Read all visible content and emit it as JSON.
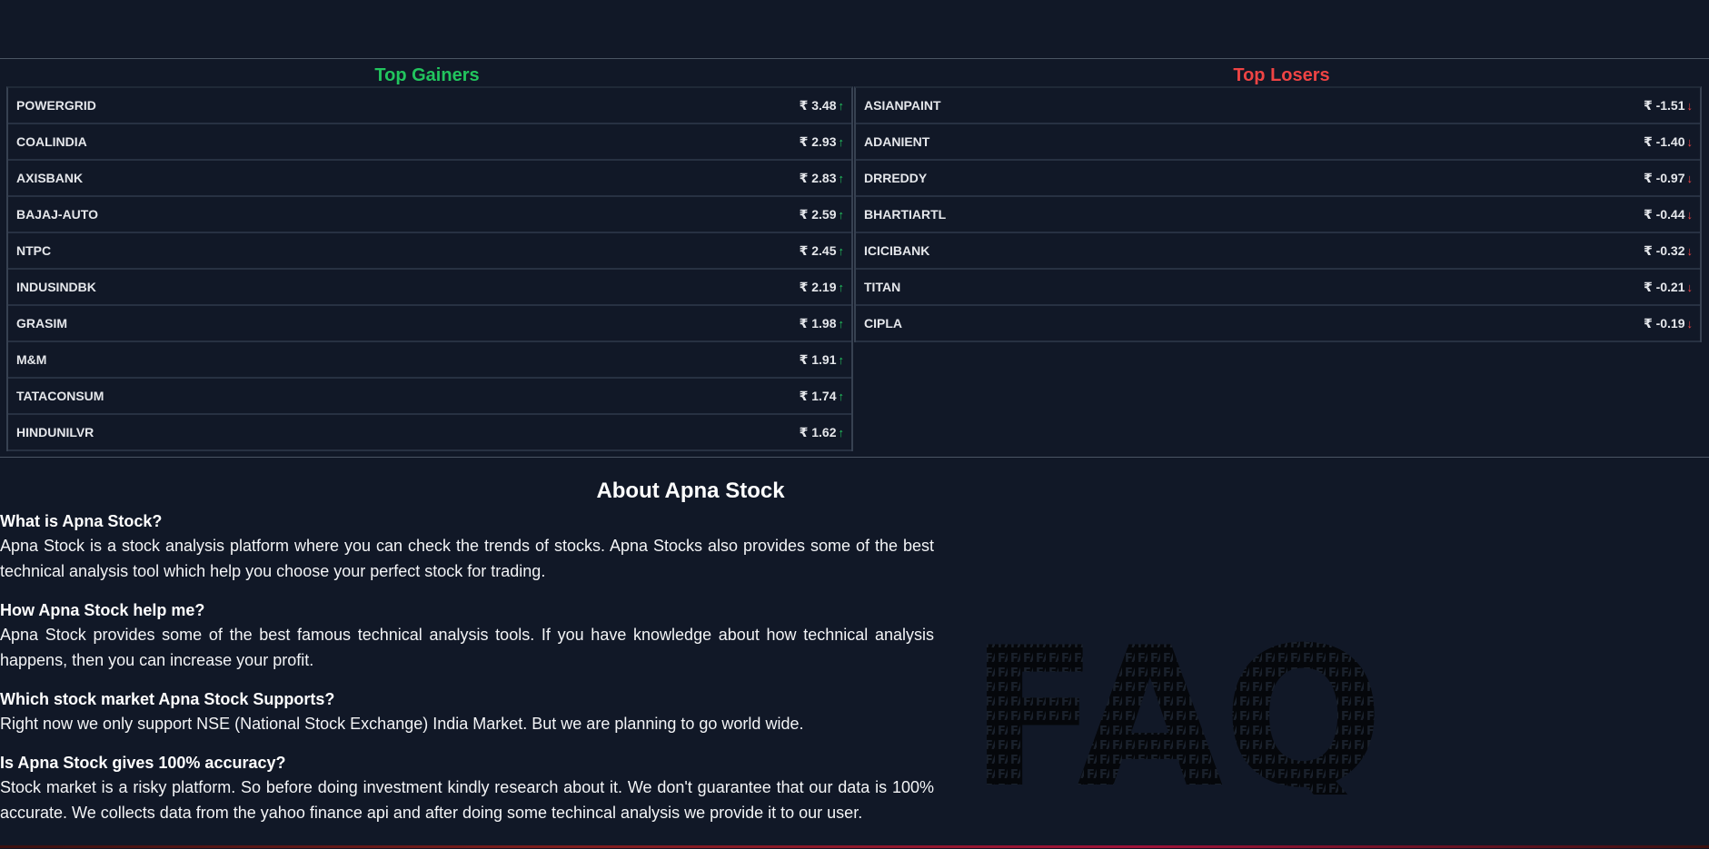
{
  "movers": {
    "gainers": {
      "title": "Top Gainers",
      "color": "#22c55e",
      "items": [
        {
          "symbol": "POWERGRID",
          "value": "₹ 3.48",
          "arrow": "↑"
        },
        {
          "symbol": "COALINDIA",
          "value": "₹ 2.93",
          "arrow": "↑"
        },
        {
          "symbol": "AXISBANK",
          "value": "₹ 2.83",
          "arrow": "↑"
        },
        {
          "symbol": "BAJAJ-AUTO",
          "value": "₹ 2.59",
          "arrow": "↑"
        },
        {
          "symbol": "NTPC",
          "value": "₹ 2.45",
          "arrow": "↑"
        },
        {
          "symbol": "INDUSINDBK",
          "value": "₹ 2.19",
          "arrow": "↑"
        },
        {
          "symbol": "GRASIM",
          "value": "₹ 1.98",
          "arrow": "↑"
        },
        {
          "symbol": "M&M",
          "value": "₹ 1.91",
          "arrow": "↑"
        },
        {
          "symbol": "TATACONSUM",
          "value": "₹ 1.74",
          "arrow": "↑"
        },
        {
          "symbol": "HINDUNILVR",
          "value": "₹ 1.62",
          "arrow": "↑"
        }
      ]
    },
    "losers": {
      "title": "Top Losers",
      "color": "#ef4444",
      "items": [
        {
          "symbol": "ASIANPAINT",
          "value": "₹ -1.51",
          "arrow": "↓"
        },
        {
          "symbol": "ADANIENT",
          "value": "₹ -1.40",
          "arrow": "↓"
        },
        {
          "symbol": "DRREDDY",
          "value": "₹ -0.97",
          "arrow": "↓"
        },
        {
          "symbol": "BHARTIARTL",
          "value": "₹ -0.44",
          "arrow": "↓"
        },
        {
          "symbol": "ICICIBANK",
          "value": "₹ -0.32",
          "arrow": "↓"
        },
        {
          "symbol": "TITAN",
          "value": "₹ -0.21",
          "arrow": "↓"
        },
        {
          "symbol": "CIPLA",
          "value": "₹ -0.19",
          "arrow": "↓"
        }
      ]
    }
  },
  "about": {
    "title": "About Apna Stock",
    "faq": [
      {
        "question": "What is Apna Stock?",
        "answer": "Apna Stock is a stock analysis platform where you can check the trends of stocks. Apna Stocks also provides some of the best technical analysis tool which help you choose your perfect stock for trading."
      },
      {
        "question": "How Apna Stock help me?",
        "answer": "Apna Stock provides some of the best famous technical analysis tools. If you have knowledge about how technical analysis happens, then you can increase your profit."
      },
      {
        "question": "Which stock market Apna Stock Supports?",
        "answer": "Right now we only support NSE (National Stock Exchange) India Market. But we are planning to go world wide."
      },
      {
        "question": "Is Apna Stock gives 100% accuracy?",
        "answer": "Stock market is a risky platform. So before doing investment kindly research about it. We don't guarantee that our data is 100% accurate. We collects data from the yahoo finance api and after doing some techincal analysis we provide it to our user."
      }
    ],
    "illustration": {
      "icon": "faq-question-marks-illustration",
      "text": "FAQ",
      "color": "#0a0e15"
    }
  }
}
